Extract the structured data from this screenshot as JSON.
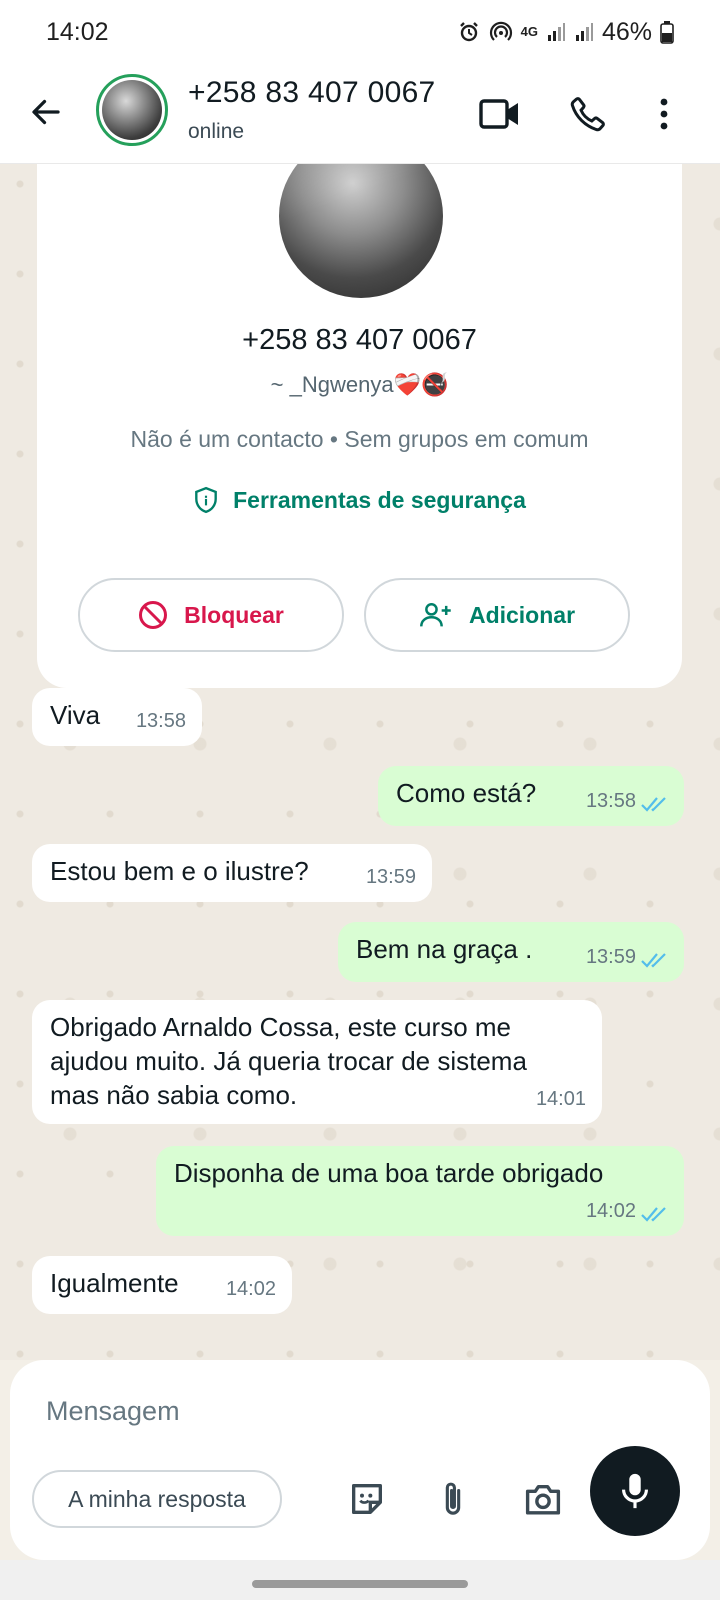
{
  "status_bar": {
    "time": "14:02",
    "network": "4G",
    "battery": "46%",
    "icons": [
      "alarm-icon",
      "hotspot-icon",
      "4g-icon",
      "signal-icon",
      "signal-icon",
      "battery-icon"
    ]
  },
  "header": {
    "title": "+258 83 407 0067",
    "subtitle": "online",
    "icons": [
      "back-arrow-icon",
      "video-call-icon",
      "phone-icon",
      "more-vert-icon"
    ]
  },
  "contact_card": {
    "phone": "+258 83 407 0067",
    "name": "~ _Ngwenya❤️‍🩹🚭",
    "info": "Não é um contacto • Sem grupos em comum",
    "safety_tools": "Ferramentas de segurança",
    "block_label": "Bloquear",
    "add_label": "Adicionar"
  },
  "messages": [
    {
      "dir": "in",
      "text": "Viva",
      "time": "13:58"
    },
    {
      "dir": "out",
      "text": "Como está?",
      "time": "13:58",
      "status": "read"
    },
    {
      "dir": "in",
      "text": "Estou bem e o ilustre?",
      "time": "13:59"
    },
    {
      "dir": "out",
      "text": "Bem na graça .",
      "time": "13:59",
      "status": "read"
    },
    {
      "dir": "in",
      "text": "Obrigado Arnaldo Cossa, este curso me ajudou muito.  Já queria trocar de sistema mas não sabia como.",
      "time": "14:01"
    },
    {
      "dir": "out",
      "text": "Disponha de uma boa tarde obrigado",
      "time": "14:02",
      "status": "read"
    },
    {
      "dir": "in",
      "text": "Igualmente",
      "time": "14:02"
    }
  ],
  "composer": {
    "placeholder": "Mensagem",
    "reply_chip": "A minha resposta",
    "icons": [
      "sticker-icon",
      "attach-icon",
      "camera-icon",
      "mic-icon"
    ]
  },
  "colors": {
    "accent_green": "#008069",
    "outgoing_bubble": "#d9fdd3",
    "incoming_bubble": "#ffffff",
    "block_red": "#d8174c",
    "read_ticks": "#53bdeb",
    "wallpaper": "#efeae2"
  }
}
